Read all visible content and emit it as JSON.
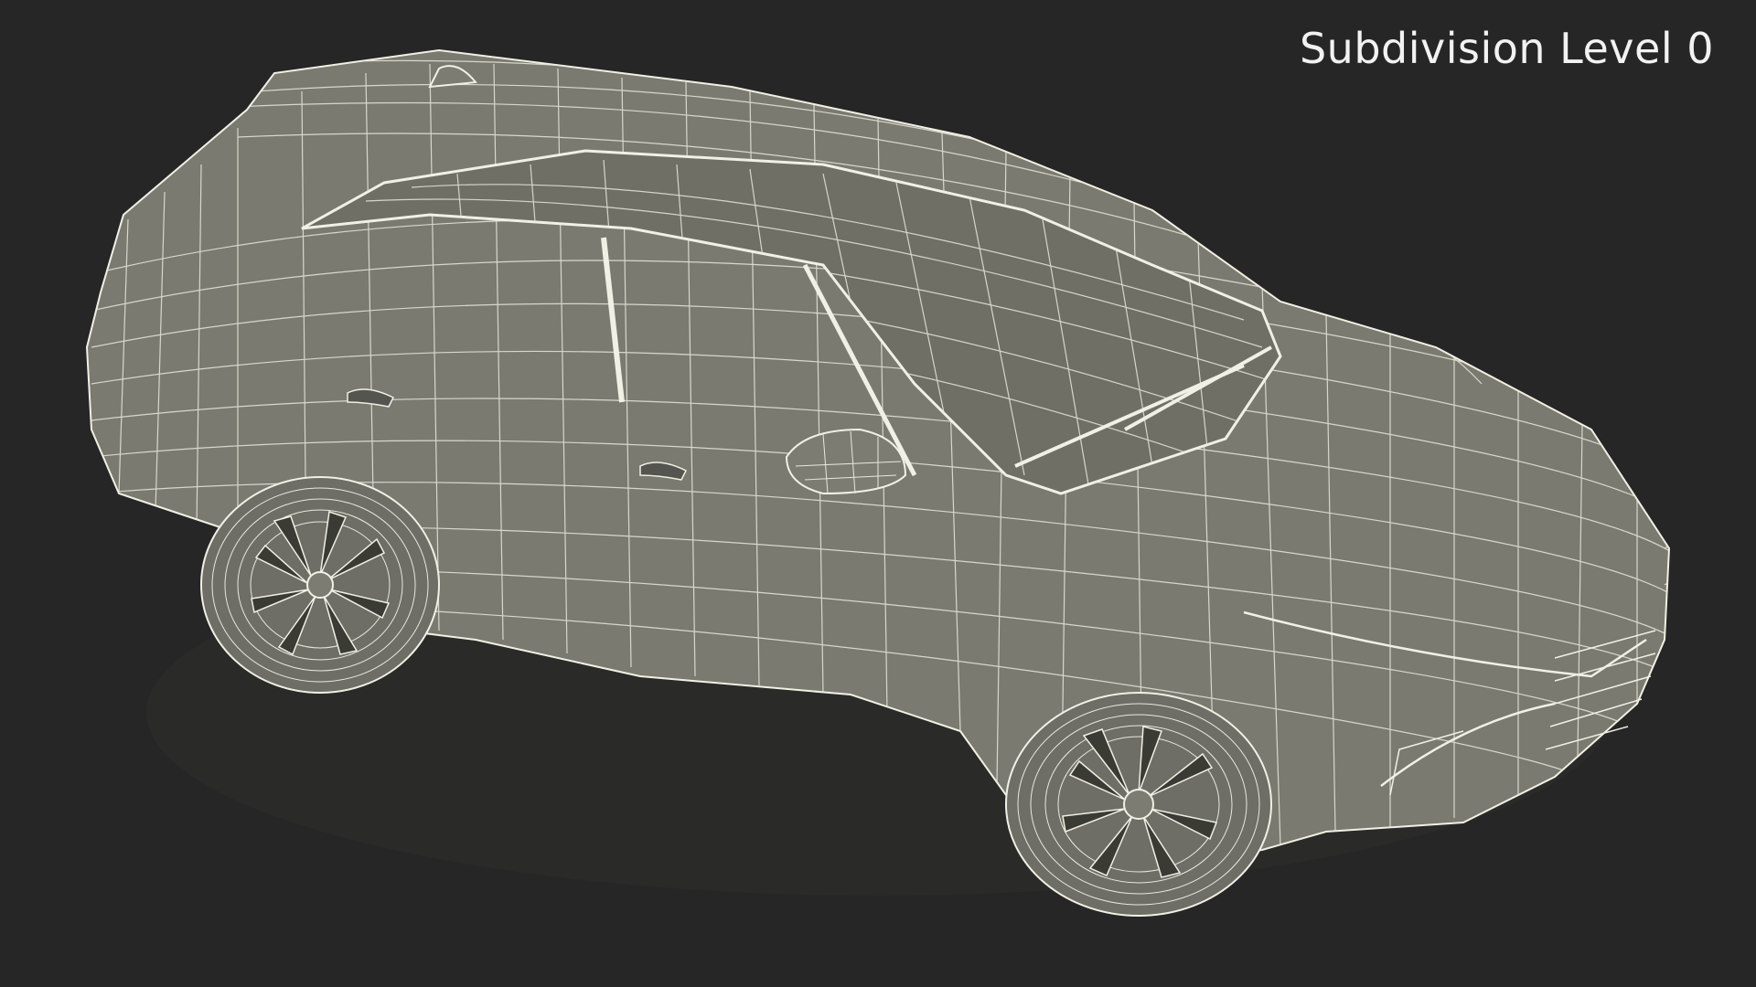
{
  "viewport": {
    "label": "Subdivision Level 0",
    "background": "#262626",
    "surface_color": "#7c7c72",
    "wire_color": "#f1f0e4",
    "shadow_color": "#4a4a44"
  }
}
